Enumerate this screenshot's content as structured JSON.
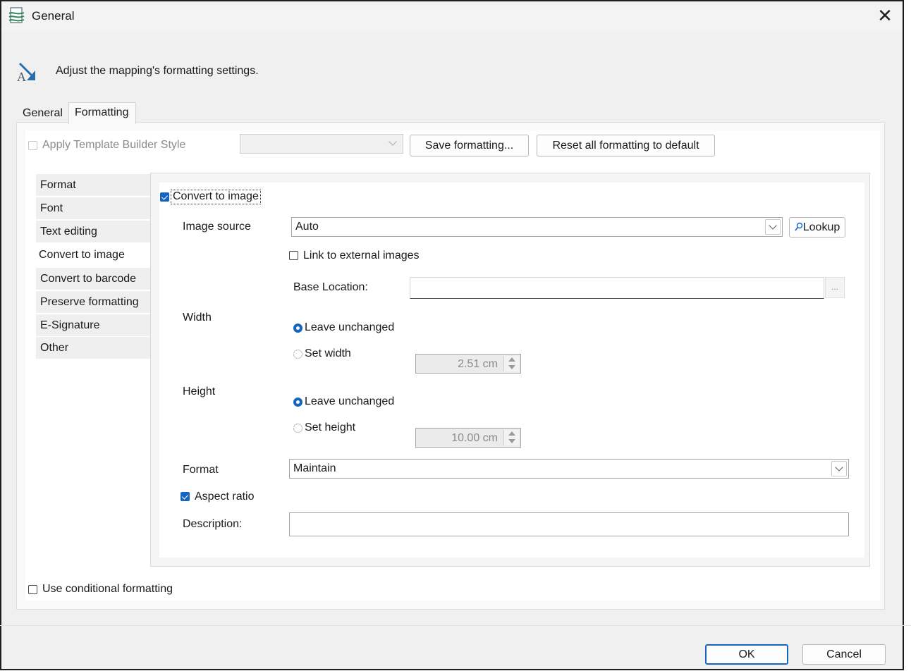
{
  "window": {
    "title": "General",
    "close_glyph": "✕"
  },
  "header": {
    "description": "Adjust the mapping's formatting settings."
  },
  "tabs": [
    {
      "label": "General",
      "active": false
    },
    {
      "label": "Formatting",
      "active": true
    }
  ],
  "toolbar": {
    "apply_style_label": "Apply Template Builder Style",
    "apply_style_checked": false,
    "style_dropdown_value": "",
    "save_button": "Save formatting...",
    "reset_button": "Reset all formatting to default"
  },
  "sidebar": {
    "items": [
      {
        "label": "Format"
      },
      {
        "label": "Font"
      },
      {
        "label": "Text editing"
      },
      {
        "label": "Convert to image",
        "selected": true
      },
      {
        "label": "Convert to barcode"
      },
      {
        "label": "Preserve formatting"
      },
      {
        "label": "E-Signature"
      },
      {
        "label": "Other"
      }
    ]
  },
  "convert": {
    "enable_label": "Convert to image",
    "enable_checked": true,
    "image_source_label": "Image source",
    "image_source_value": "Auto",
    "lookup_button": "Lookup",
    "link_external_label": "Link to external images",
    "link_external_checked": false,
    "base_location_label": "Base Location:",
    "base_location_value": "",
    "browse_button": "...",
    "width": {
      "label": "Width",
      "option_unchanged": "Leave unchanged",
      "option_set": "Set width",
      "selected": "unchanged",
      "value": "2.51 cm"
    },
    "height": {
      "label": "Height",
      "option_unchanged": "Leave unchanged",
      "option_set": "Set height",
      "selected": "unchanged",
      "value": "10.00 cm"
    },
    "format_label": "Format",
    "format_value": "Maintain",
    "aspect_ratio_label": "Aspect ratio",
    "aspect_ratio_checked": true,
    "description_label": "Description:",
    "description_value": ""
  },
  "conditional": {
    "label": "Use conditional formatting",
    "checked": false
  },
  "footer": {
    "ok": "OK",
    "cancel": "Cancel"
  },
  "colors": {
    "accent": "#1565c0",
    "window_bg": "#f0f0f0"
  },
  "icons": {
    "app": "template-builder-icon",
    "header": "format-arrow-icon",
    "lookup": "magnifier-icon"
  }
}
